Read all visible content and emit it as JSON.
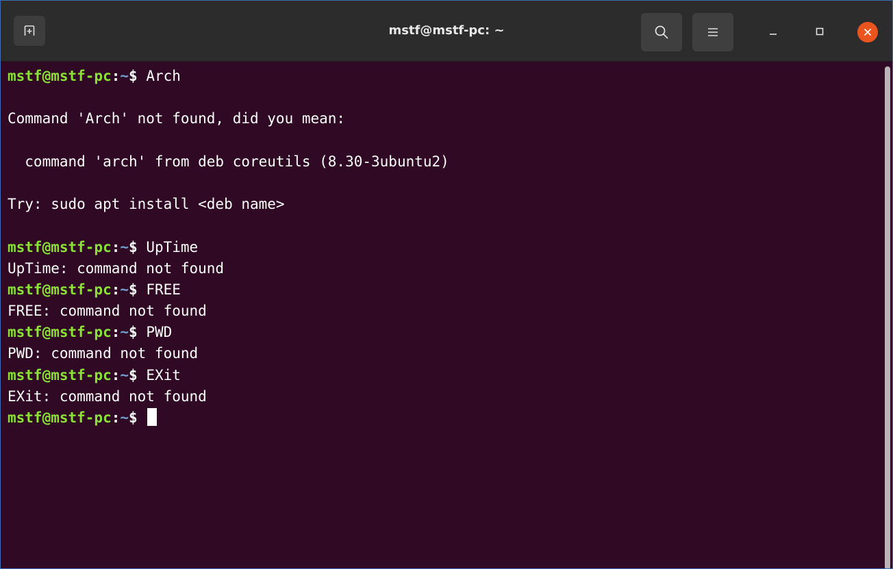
{
  "window": {
    "title": "mstf@mstf-pc: ~",
    "buttons": {
      "new_tab_icon": "new-tab-icon",
      "search_icon": "search-icon",
      "menu_icon": "hamburger-menu-icon",
      "minimize_icon": "minimize-icon",
      "maximize_icon": "maximize-icon",
      "close_icon": "close-icon"
    },
    "colors": {
      "titlebar": "#2c2c2c",
      "terminal_bg": "#300a24",
      "prompt_user": "#8ae234",
      "prompt_path": "#729fcf",
      "close_button": "#e9541f"
    }
  },
  "terminal": {
    "prompt": {
      "user_host": "mstf@mstf-pc",
      "colon": ":",
      "path": "~",
      "symbol": "$ "
    },
    "lines": [
      {
        "type": "prompt",
        "command": "Arch"
      },
      {
        "type": "output",
        "text": ""
      },
      {
        "type": "output",
        "text": "Command 'Arch' not found, did you mean:"
      },
      {
        "type": "output",
        "text": ""
      },
      {
        "type": "output",
        "text": "  command 'arch' from deb coreutils (8.30-3ubuntu2)"
      },
      {
        "type": "output",
        "text": ""
      },
      {
        "type": "output",
        "text": "Try: sudo apt install <deb name>"
      },
      {
        "type": "output",
        "text": ""
      },
      {
        "type": "prompt",
        "command": "UpTime"
      },
      {
        "type": "output",
        "text": "UpTime: command not found"
      },
      {
        "type": "prompt",
        "command": "FREE"
      },
      {
        "type": "output",
        "text": "FREE: command not found"
      },
      {
        "type": "prompt",
        "command": "PWD"
      },
      {
        "type": "output",
        "text": "PWD: command not found"
      },
      {
        "type": "prompt",
        "command": "EXit"
      },
      {
        "type": "output",
        "text": "EXit: command not found"
      },
      {
        "type": "prompt",
        "command": "",
        "cursor": true
      }
    ]
  }
}
